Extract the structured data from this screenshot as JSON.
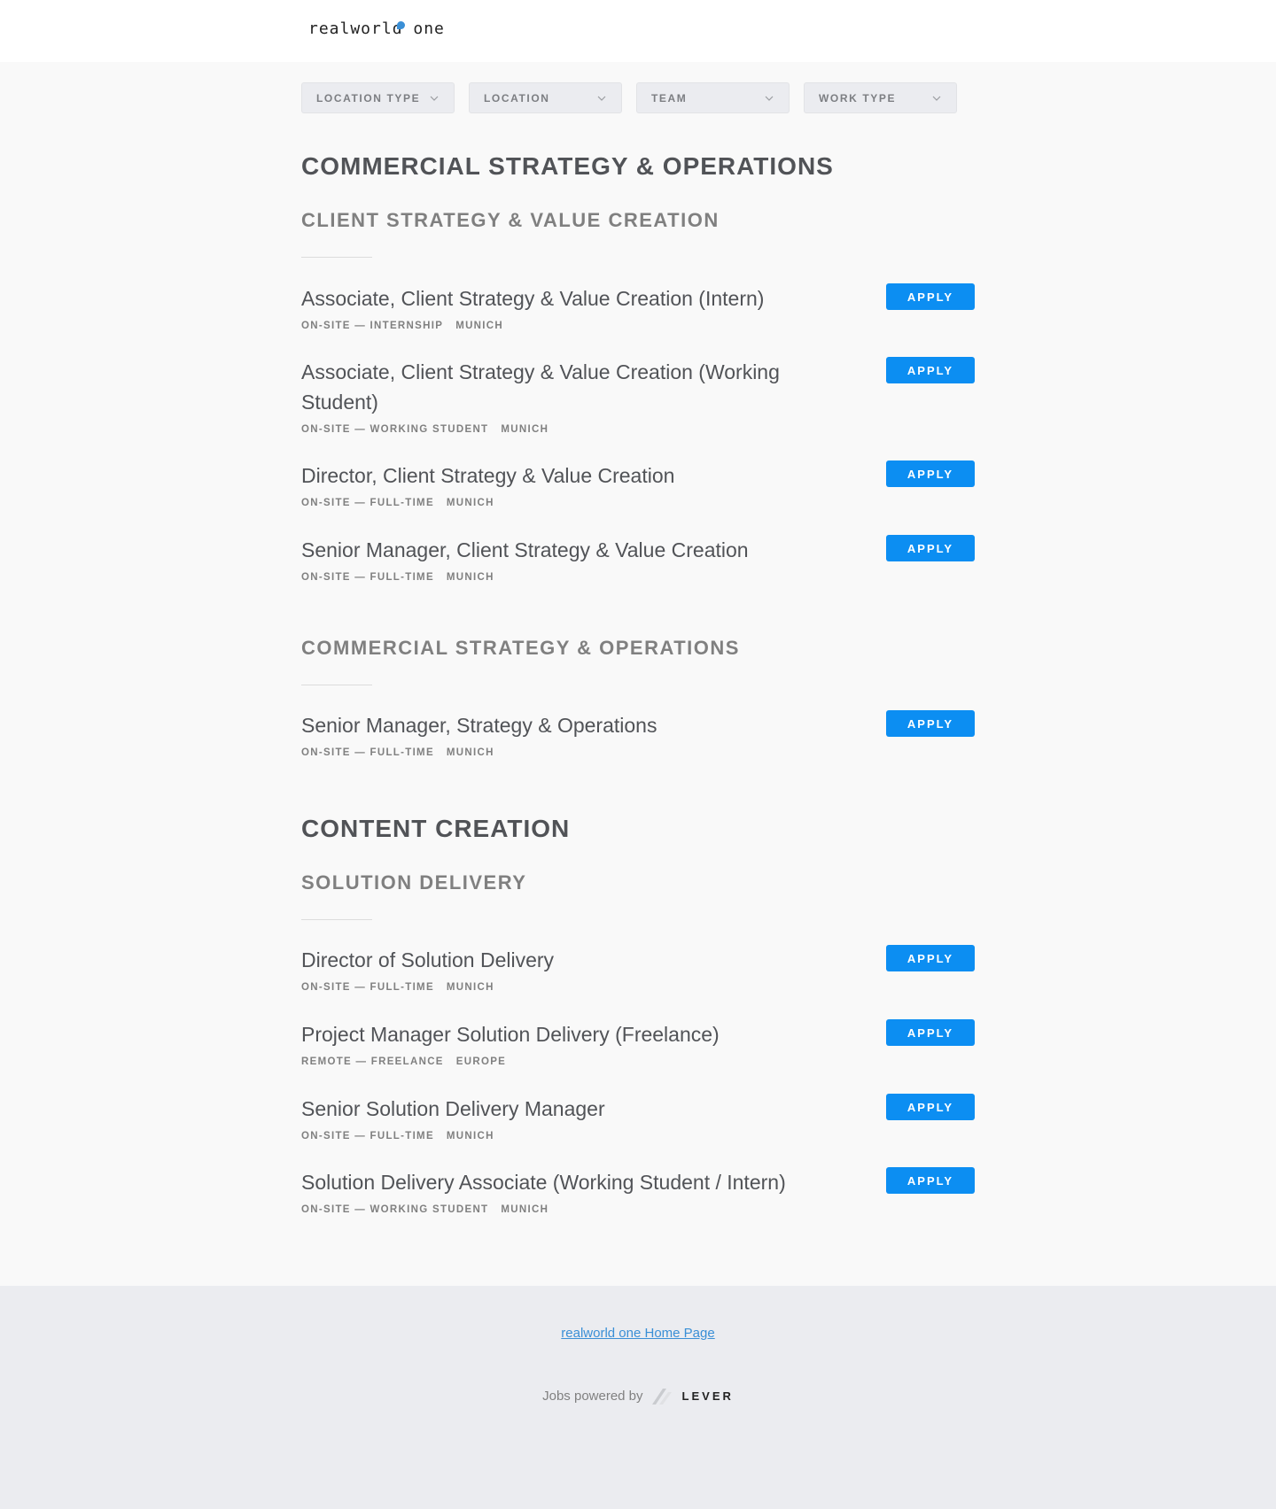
{
  "header": {
    "logo_text": "realworld one"
  },
  "filters": [
    {
      "label": "LOCATION TYPE"
    },
    {
      "label": "LOCATION"
    },
    {
      "label": "TEAM"
    },
    {
      "label": "WORK TYPE"
    }
  ],
  "groups": [
    {
      "title": "COMMERCIAL STRATEGY & OPERATIONS",
      "subgroups": [
        {
          "title": "CLIENT STRATEGY & VALUE CREATION",
          "postings": [
            {
              "title": "Associate, Client Strategy & Value Creation (Intern)",
              "commitment": "ON-SITE — INTERNSHIP",
              "location": "MUNICH",
              "apply": "APPLY"
            },
            {
              "title": "Associate, Client Strategy & Value Creation (Working Student)",
              "commitment": "ON-SITE — WORKING STUDENT",
              "location": "MUNICH",
              "apply": "APPLY"
            },
            {
              "title": "Director, Client Strategy & Value Creation",
              "commitment": "ON-SITE — FULL-TIME",
              "location": "MUNICH",
              "apply": "APPLY"
            },
            {
              "title": "Senior Manager, Client Strategy & Value Creation",
              "commitment": "ON-SITE — FULL-TIME",
              "location": "MUNICH",
              "apply": "APPLY"
            }
          ]
        },
        {
          "title": "COMMERCIAL STRATEGY & OPERATIONS",
          "postings": [
            {
              "title": "Senior Manager, Strategy & Operations",
              "commitment": "ON-SITE — FULL-TIME",
              "location": "MUNICH",
              "apply": "APPLY"
            }
          ]
        }
      ]
    },
    {
      "title": "CONTENT CREATION",
      "subgroups": [
        {
          "title": "SOLUTION DELIVERY",
          "postings": [
            {
              "title": "Director of Solution Delivery",
              "commitment": "ON-SITE — FULL-TIME",
              "location": "MUNICH",
              "apply": "APPLY"
            },
            {
              "title": "Project Manager Solution Delivery (Freelance)",
              "commitment": "REMOTE — FREELANCE",
              "location": "EUROPE",
              "apply": "APPLY"
            },
            {
              "title": "Senior Solution Delivery Manager",
              "commitment": "ON-SITE — FULL-TIME",
              "location": "MUNICH",
              "apply": "APPLY"
            },
            {
              "title": "Solution Delivery Associate (Working Student / Intern)",
              "commitment": "ON-SITE — WORKING STUDENT",
              "location": "MUNICH",
              "apply": "APPLY"
            }
          ]
        }
      ]
    }
  ],
  "footer": {
    "home_link": "realworld one Home Page",
    "powered_by": "Jobs powered by",
    "lever": "LEVER"
  },
  "colors": {
    "accent": "#0c8ef2",
    "link": "#3a8fd6"
  }
}
